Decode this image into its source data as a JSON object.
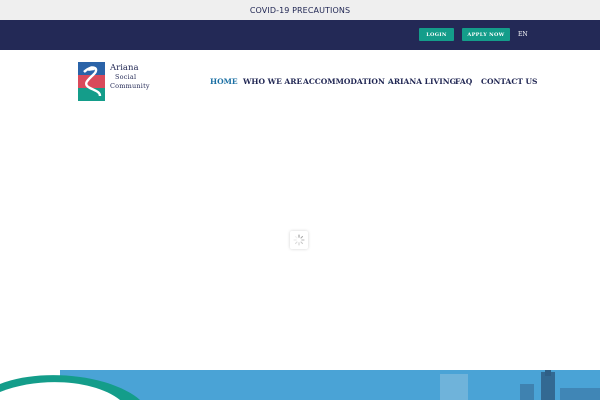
{
  "announcement": {
    "text": "COVID-19 PRECAUTIONS"
  },
  "topbar": {
    "login_label": "LOGIN",
    "apply_label": "APPLY NOW",
    "language": "EN"
  },
  "logo": {
    "line1": "Ariana",
    "line2": "Social",
    "line3": "Community"
  },
  "nav": {
    "items": [
      {
        "label": "HOME",
        "active": true
      },
      {
        "label": "WHO WE ARE"
      },
      {
        "label": "ACCOMMODATION",
        "has_dropdown": true
      },
      {
        "label": "ARIANA LIVING"
      },
      {
        "label": "FAQ"
      },
      {
        "label": "CONTACT US"
      }
    ],
    "dropdown_icon": "chevron-down-icon"
  },
  "colors": {
    "dark_navy": "#232956",
    "teal": "#149d8a",
    "active_blue": "#1a6fa3",
    "light_gray": "#efefef",
    "sky_blue": "#4aa3d6"
  }
}
